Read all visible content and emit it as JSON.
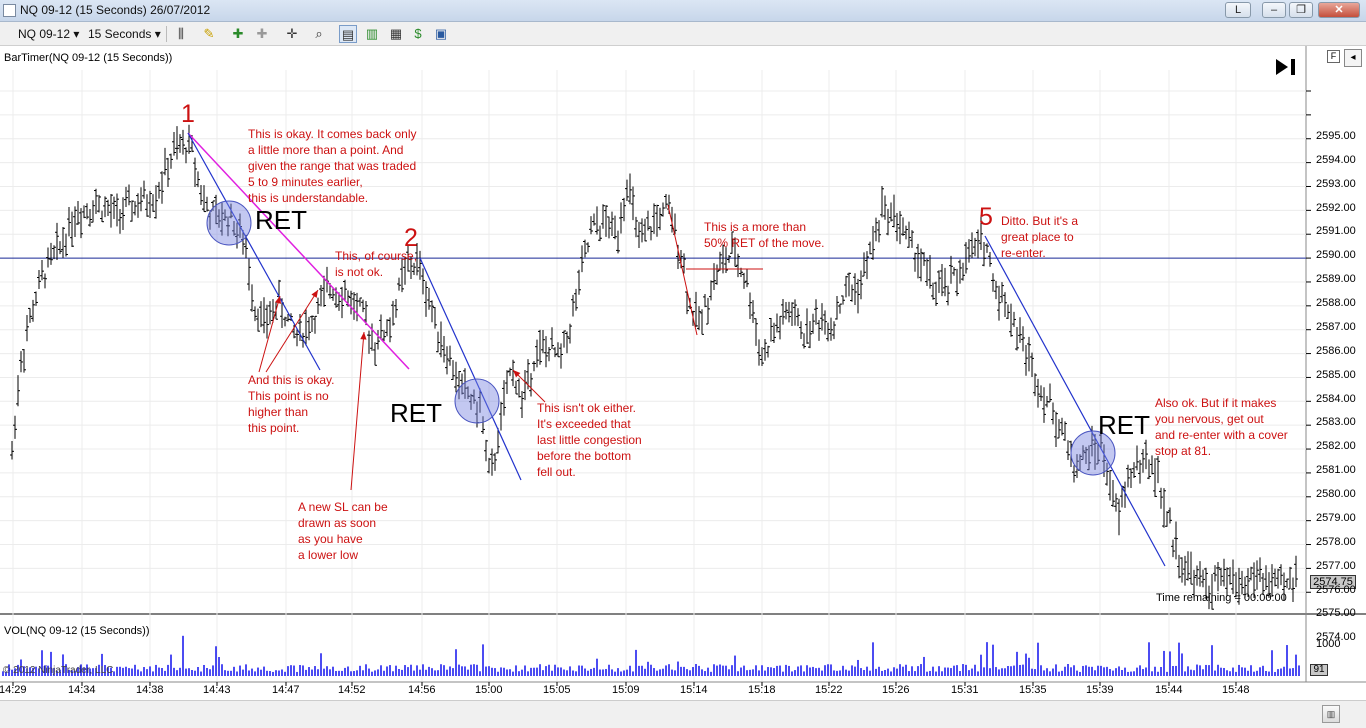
{
  "window": {
    "title": "NQ 09-12 (15 Seconds)  26/07/2012",
    "buttons": {
      "l": "L",
      "minimize": "–",
      "maximize": "❐",
      "close": "✕"
    }
  },
  "toolbar": {
    "instrument": "NQ 09-12",
    "interval": "15 Seconds",
    "icons": [
      "bar-type-icon",
      "pencil-icon",
      "crosshair-icon",
      "zoom-icon",
      "chart-style-icon",
      "properties-icon",
      "dollar-icon",
      "panel-icon"
    ]
  },
  "chart": {
    "indicator_label": "BarTimer(NQ 09-12 (15 Seconds))",
    "volume_label": "VOL(NQ 09-12 (15 Seconds))",
    "copyright": "© 2012 NinjaTrader, LLC",
    "time_remaining": "Time remaining = 00:00:00",
    "last_price": "2574.75",
    "last_volume": "91",
    "f_button": "F",
    "y_axis": [
      "2595.00",
      "2594.00",
      "2593.00",
      "2592.00",
      "2591.00",
      "2590.00",
      "2589.00",
      "2588.00",
      "2587.00",
      "2586.00",
      "2585.00",
      "2584.00",
      "2583.00",
      "2582.00",
      "2581.00",
      "2580.00",
      "2579.00",
      "2578.00",
      "2577.00",
      "2576.00",
      "2575.00",
      "2574.00"
    ],
    "volume_axis": "1000",
    "x_axis": [
      "14:29",
      "14:34",
      "14:38",
      "14:43",
      "14:47",
      "14:52",
      "14:56",
      "15:00",
      "15:05",
      "15:09",
      "15:14",
      "15:18",
      "15:22",
      "15:26",
      "15:31",
      "15:35",
      "15:39",
      "15:44",
      "15:48"
    ],
    "horizontal_line_price": 2588.0,
    "colors": {
      "annotation": "#cc1111",
      "trendline": "#2233cc",
      "magenta_line": "#e020e0",
      "circle_fill": "#7b86e0",
      "bars": "#000000",
      "volume": "#1010ee"
    }
  },
  "annotations": {
    "num1": "1",
    "num2": "2",
    "num5": "5",
    "ret1": "RET",
    "ret2": "RET",
    "ret3": "RET",
    "note1": "This is okay. It comes back only\na little more than a point. And\ngiven the range that was traded\n5 to 9 minutes earlier,\nthis is understandable.",
    "note2": "This, of course,\nis not ok.",
    "note3": "And this is okay.\nThis point is no\nhigher than\nthis point.",
    "note4": "A new SL can be\ndrawn as soon\nas you have\na lower low",
    "note5": "This isn't ok either.\nIt's exceeded that\nlast little congestion\nbefore the bottom\nfell out.",
    "note6": "This is a more than\n50% RET of the move.",
    "note7": "Ditto. But it's a\ngreat place to\nre-enter.",
    "note8": "Also ok. But if it makes\nyou nervous, get out\nand re-enter with a cover\nstop at 81."
  }
}
